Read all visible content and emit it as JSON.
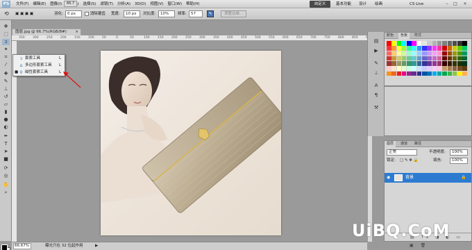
{
  "app": {
    "logo": "PS",
    "menu": [
      "文件(F)",
      "编辑(E)",
      "图像(I)",
      "图层(L)",
      "选择(S)",
      "滤镜(T)",
      "分析(A)",
      "3D(D)",
      "视图(V)",
      "窗口(W)",
      "帮助(H)"
    ],
    "zoom_mini": "66.7",
    "workspace_active": "自定义",
    "workspace_items": [
      "基本功能",
      "设计",
      "绘画"
    ],
    "cs_live": "CS Live"
  },
  "options_bar": {
    "feather_label": "羽化:",
    "feather_value": "0 px",
    "antialias_label": "消除锯齿",
    "width_label": "宽度:",
    "width_value": "10 px",
    "contrast_label": "对比度:",
    "contrast_value": "10%",
    "frequency_label": "频率:",
    "frequency_value": "57",
    "refine_edge_label": "调整边缘..."
  },
  "document": {
    "tab_title": "图层.jpg @ 66.7%(RGB/8#)",
    "ruler_marks": [
      "350",
      "300",
      "250",
      "200",
      "150",
      "100",
      "50",
      "0",
      "50",
      "100",
      "150",
      "200",
      "250",
      "300",
      "350",
      "400",
      "450",
      "500",
      "550",
      "600",
      "650",
      "700",
      "750",
      "800",
      "850",
      "900"
    ]
  },
  "tool_flyout": {
    "items": [
      {
        "label": "套索工具",
        "key": "L",
        "selected": false
      },
      {
        "label": "多边形套索工具",
        "key": "L",
        "selected": false
      },
      {
        "label": "磁性套索工具",
        "key": "L",
        "selected": true
      }
    ]
  },
  "panels": {
    "swatches_tabs": [
      "颜色",
      "色板",
      "样式"
    ],
    "swatch_colors": [
      "#ff0000",
      "#ffff00",
      "#00ff00",
      "#00ffff",
      "#0000ff",
      "#ff00ff",
      "#ffffff",
      "#e6e6e6",
      "#cccccc",
      "#b3b3b3",
      "#999999",
      "#808080",
      "#666666",
      "#4d4d4d",
      "#333333",
      "#000000",
      "#ff3333",
      "#ff9933",
      "#ffff33",
      "#99ff33",
      "#33ff99",
      "#33ffff",
      "#3399ff",
      "#3333ff",
      "#9933ff",
      "#ff33ff",
      "#ff3399",
      "#cc0000",
      "#cc6600",
      "#cccc00",
      "#66cc00",
      "#00cc66",
      "#ff6666",
      "#ffcc66",
      "#ffff99",
      "#ccff99",
      "#99ffcc",
      "#99ffff",
      "#99ccff",
      "#9999ff",
      "#cc99ff",
      "#ff99ff",
      "#ff99cc",
      "#990000",
      "#994c00",
      "#999900",
      "#4c9900",
      "#009966",
      "#cc3333",
      "#cc9933",
      "#cccc66",
      "#99cc66",
      "#66cc99",
      "#66cccc",
      "#6699cc",
      "#6666cc",
      "#9966cc",
      "#cc66cc",
      "#cc6699",
      "#660000",
      "#663300",
      "#666600",
      "#336600",
      "#006633",
      "#993333",
      "#996633",
      "#999966",
      "#669966",
      "#339966",
      "#339999",
      "#336699",
      "#333399",
      "#663399",
      "#993399",
      "#993366",
      "#330000",
      "#331a00",
      "#333300",
      "#1a3300",
      "#00331a",
      "#ffcccc",
      "#ffe5cc",
      "#ffffcc",
      "#e5ffcc",
      "#ccffe5",
      "#ccffff",
      "#cce5ff",
      "#ccccff",
      "#e5ccff",
      "#ffccff",
      "#ffcce5",
      "#c69c6d",
      "#a67c52",
      "#8c6239",
      "#754c24",
      "#603913",
      "#f7941d",
      "#f26522",
      "#ed1c24",
      "#ec008c",
      "#92278f",
      "#662d91",
      "#2e3192",
      "#0054a6",
      "#0072bc",
      "#00aeef",
      "#00a99d",
      "#00a651",
      "#39b54a",
      "#8dc63f",
      "#fff200",
      "#fbaf5d"
    ],
    "layers_tabs": [
      "图层",
      "通道",
      "路径"
    ],
    "blend_mode": "正常",
    "opacity_label": "不透明度:",
    "opacity_value": "100%",
    "lock_label": "锁定:",
    "fill_label": "填充:",
    "fill_value": "100%",
    "layer_name": "背景"
  },
  "status": {
    "zoom": "66.67%",
    "info": "曝光只在 32 位起作用"
  },
  "watermark": "UiBQ.CoM"
}
